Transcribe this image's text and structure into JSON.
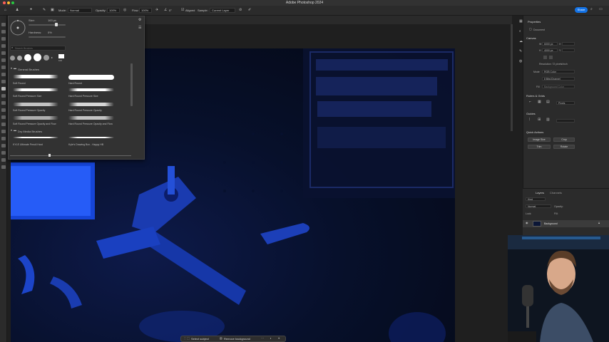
{
  "window": {
    "title": "Adobe Photoshop 2024",
    "colors": {
      "close": "#ff5f57",
      "minimize": "#febc2e",
      "zoom": "#28c840",
      "accent": "#1473e6"
    }
  },
  "options_bar": {
    "mode_label": "Mode:",
    "mode_value": "Normal",
    "opacity_label": "Opacity:",
    "opacity_value": "100%",
    "flow_label": "Flow:",
    "flow_value": "100%",
    "angle_value": "0°",
    "aligned_label": "Aligned",
    "sample_label": "Sample:",
    "sample_value": "Current Layer",
    "share_label": "Share"
  },
  "brush_panel": {
    "size_label": "Size:",
    "size_value": "163 px",
    "hardness_label": "Hardness:",
    "hardness_value": "0%",
    "search_placeholder": "Search Brushes",
    "recent_size": "100",
    "groups": [
      {
        "name": "General Brushes",
        "brushes": [
          "Soft Round",
          "Hard Round",
          "Soft Round Pressure Size",
          "Hard Round Pressure Size",
          "Soft Round Pressure Opacity",
          "Hard Round Pressure Opacity",
          "Soft Round Pressure Opacity and Flow",
          "Hard Round Pressure Opacity and Flow"
        ]
      },
      {
        "name": "Dry Media Brushes",
        "brushes": [
          "KYLE Ultimate Pencil Hard",
          "Kyle's Drawing Box - Happy HB"
        ]
      }
    ]
  },
  "properties": {
    "tabs": [
      "Properties"
    ],
    "document_label": "Document",
    "canvas_head": "Canvas",
    "width_label": "W",
    "width_value": "6000 px",
    "x_label": "X",
    "height_label": "H",
    "height_value": "4000 px",
    "y_label": "Y",
    "resolution": "Resolution: 72 pixels/inch",
    "mode_label": "Mode",
    "mode_value": "RGB Color",
    "bit_depth": "8 Bits/Channel",
    "fill_label": "Fill",
    "fill_value": "Background Color",
    "rulers_head": "Rulers & Grids",
    "units_value": "Pixels",
    "guides_head": "Guides",
    "quick_actions_head": "Quick Actions",
    "quick_actions": [
      "Image Size",
      "Crop",
      "Trim",
      "Rotate"
    ]
  },
  "layers": {
    "tabs": [
      "Layers",
      "Channels"
    ],
    "kind_placeholder": "Kind",
    "blend_value": "Normal",
    "opacity_label": "Opacity:",
    "lock_label": "Lock:",
    "fill_label": "Fill:",
    "items": [
      {
        "name": "Background"
      }
    ]
  },
  "contextual_bar": {
    "select_subject": "Select subject",
    "remove_background": "Remove background"
  }
}
